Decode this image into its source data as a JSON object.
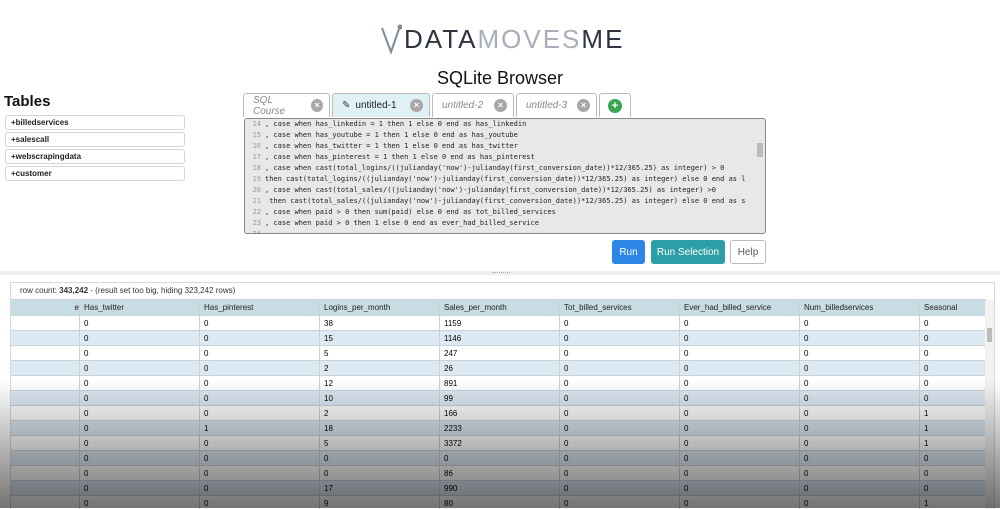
{
  "logo": {
    "word_part1": "DATA",
    "word_part2": "MOVES",
    "word_part3": "ME"
  },
  "app_title": "SQLite Browser",
  "tables_heading": "Tables",
  "tables": [
    "+billedservices",
    "+salescall",
    "+webscrapingdata",
    "+customer"
  ],
  "tabs": [
    {
      "label": "SQL Course",
      "close": "×"
    },
    {
      "label": "untitled-1",
      "close": "×",
      "edit_icon": "✎"
    },
    {
      "label": "untitled-2",
      "close": "×"
    },
    {
      "label": "untitled-3",
      "close": "×"
    }
  ],
  "add_tab": "+",
  "editor_lines": [
    {
      "n": "14",
      "code": ", case when has_linkedin = 1 then 1 else 0 end as has_linkedin"
    },
    {
      "n": "15",
      "code": ", case when has_youtube = 1 then 1 else 0 end as has_youtube"
    },
    {
      "n": "16",
      "code": ", case when has_twitter = 1 then 1 else 0 end as has_twitter"
    },
    {
      "n": "17",
      "code": ", case when has_pinterest = 1 then 1 else 0 end as has_pinterest"
    },
    {
      "n": "18",
      "code": ", case when cast(total_logins/((julianday('now')-julianday(first_conversion_date))*12/365.25) as integer) > 0"
    },
    {
      "n": "19",
      "code": "then cast(total_logins/((julianday('now')-julianday(first_conversion_date))*12/365.25) as integer) else 0 end as l"
    },
    {
      "n": "20",
      "code": ", case when cast(total_sales/((julianday('now')-julianday(first_conversion_date))*12/365.25) as integer) >0"
    },
    {
      "n": "21",
      "code": " then cast(total_sales/((julianday('now')-julianday(first_conversion_date))*12/365.25) as integer) else 0 end as s"
    },
    {
      "n": "22",
      "code": ", case when paid > 0 then sum(paid) else 0 end as tot_billed_services"
    },
    {
      "n": "23",
      "code": ", case when paid > 0 then 1 else 0 end as ever_had_billed_service"
    },
    {
      "n": "24",
      "code": ""
    }
  ],
  "buttons": {
    "run": "Run",
    "run_selection": "Run Selection",
    "help": "Help"
  },
  "result": {
    "row_count_label": "row count:",
    "row_count": "343,242",
    "note": "- (result set too big, hiding 323,242 rows)"
  },
  "columns": [
    "e",
    "Has_twitter",
    "Has_pinterest",
    "Logins_per_month",
    "Sales_per_month",
    "Tot_billed_services",
    "Ever_had_billed_service",
    "Num_billedservices",
    "Seasonal"
  ],
  "rows": [
    [
      "",
      "0",
      "0",
      "38",
      "1159",
      "0",
      "0",
      "0",
      "0"
    ],
    [
      "",
      "0",
      "0",
      "15",
      "1146",
      "0",
      "0",
      "0",
      "0"
    ],
    [
      "",
      "0",
      "0",
      "5",
      "247",
      "0",
      "0",
      "0",
      "0"
    ],
    [
      "",
      "0",
      "0",
      "2",
      "26",
      "0",
      "0",
      "0",
      "0"
    ],
    [
      "",
      "0",
      "0",
      "12",
      "891",
      "0",
      "0",
      "0",
      "0"
    ],
    [
      "",
      "0",
      "0",
      "10",
      "99",
      "0",
      "0",
      "0",
      "0"
    ],
    [
      "",
      "0",
      "0",
      "2",
      "166",
      "0",
      "0",
      "0",
      "1"
    ],
    [
      "",
      "0",
      "1",
      "18",
      "2233",
      "0",
      "0",
      "0",
      "1"
    ],
    [
      "",
      "0",
      "0",
      "5",
      "3372",
      "0",
      "0",
      "0",
      "1"
    ],
    [
      "",
      "0",
      "0",
      "0",
      "0",
      "0",
      "0",
      "0",
      "0"
    ],
    [
      "",
      "0",
      "0",
      "0",
      "86",
      "0",
      "0",
      "0",
      "0"
    ],
    [
      "",
      "0",
      "0",
      "17",
      "990",
      "0",
      "0",
      "0",
      "0"
    ],
    [
      "",
      "0",
      "0",
      "9",
      "80",
      "0",
      "0",
      "0",
      "1"
    ]
  ],
  "colors": {
    "run": "#2c86e6",
    "run_selection": "#2c9fa6",
    "header_bg": "#c8dde3",
    "row_alt": "#dde9f3",
    "add_tab": "#3aa652"
  }
}
